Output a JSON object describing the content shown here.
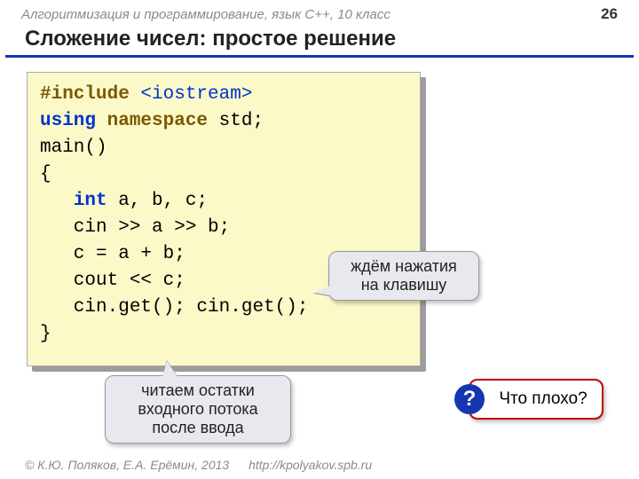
{
  "header": {
    "course": "Алгоритмизация и программирование, язык  C++, 10 класс",
    "page_number": "26"
  },
  "title": "Сложение чисел: простое решение",
  "code": {
    "l1a": "#include ",
    "l1b": "<iostream>",
    "l2a": "using",
    "l2b": " namespace ",
    "l2c": "std;",
    "l3": "main()",
    "l4": "{",
    "l5a": "   ",
    "l5b": "int",
    "l5c": " a, b, c;",
    "l6": "   cin >> a >> b;",
    "l7": "   c = a + b;",
    "l8": "   cout << c;",
    "l9": "   cin.get(); cin.get();",
    "l10": "}"
  },
  "callouts": {
    "wait_key": "ждём нажатия\nна клавишу",
    "read_rest": "читаем остатки\nвходного потока\nпосле ввода",
    "bad_q_mark": "?",
    "bad_label": "Что плохо?"
  },
  "footer": {
    "copyright": "© К.Ю. Поляков, Е.А. Ерёмин, 2013",
    "url": "http://kpolyakov.spb.ru"
  }
}
